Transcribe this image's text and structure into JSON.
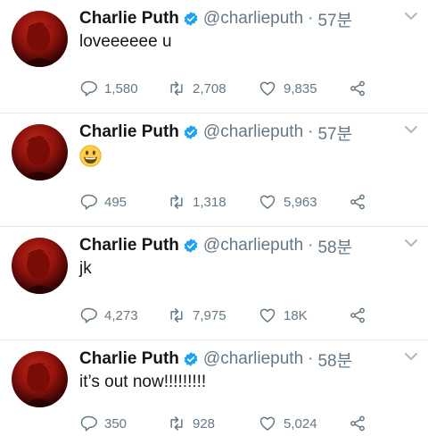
{
  "tweets": [
    {
      "name": "Charlie Puth",
      "handle": "@charlieputh",
      "separator": "·",
      "time": "57분",
      "text": "loveeeeee u",
      "emoji": "",
      "replies": "1,580",
      "retweets": "2,708",
      "likes": "9,835"
    },
    {
      "name": "Charlie Puth",
      "handle": "@charlieputh",
      "separator": "·",
      "time": "57분",
      "text": "",
      "emoji": "grinning-face-emoji",
      "replies": "495",
      "retweets": "1,318",
      "likes": "5,963"
    },
    {
      "name": "Charlie Puth",
      "handle": "@charlieputh",
      "separator": "·",
      "time": "58분",
      "text": "jk",
      "emoji": "",
      "replies": "4,273",
      "retweets": "7,975",
      "likes": "18K"
    },
    {
      "name": "Charlie Puth",
      "handle": "@charlieputh",
      "separator": "·",
      "time": "58분",
      "text": "it’s out now!!!!!!!!!",
      "emoji": "",
      "replies": "350",
      "retweets": "928",
      "likes": "5,024"
    }
  ],
  "colors": {
    "verified": "#1da1f2",
    "secondary_text": "#657786",
    "divider": "#e1e8ed"
  }
}
